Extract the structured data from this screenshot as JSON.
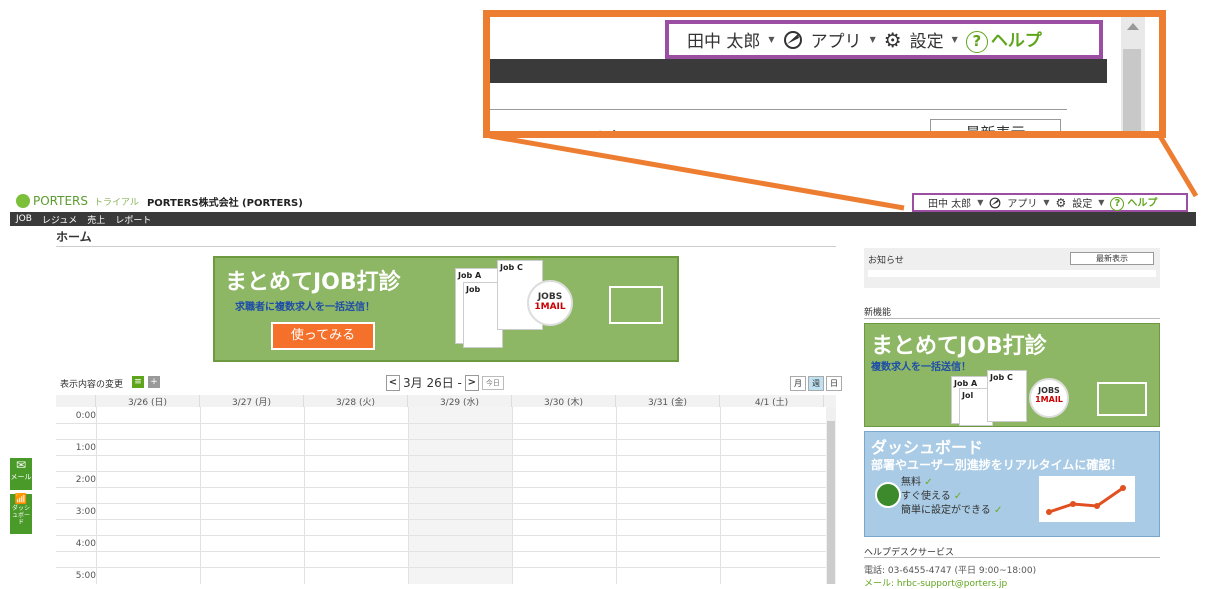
{
  "colors": {
    "accent_orange": "#ed7d31",
    "highlight_purple": "#9c4ea3",
    "brand_green": "#5fa51c",
    "nav_dark": "#3a3a3a"
  },
  "zoom": {
    "user_name": "田中 太郎",
    "apps_label": "アプリ",
    "settings_label": "設定",
    "help_label": "ヘルプ",
    "notice_label": "お知らせ",
    "latest_button": "最新表示"
  },
  "header": {
    "logo_text": "PORTERS",
    "trial_label": "トライアル",
    "company": "PORTERS株式会社 (PORTERS)",
    "user_name": "田中 太郎",
    "apps_label": "アプリ",
    "settings_label": "設定",
    "help_label": "ヘルプ"
  },
  "nav": {
    "items": [
      "JOB",
      "レジュメ",
      "売上",
      "レポート"
    ]
  },
  "page": {
    "title": "ホーム"
  },
  "banner": {
    "title": "まとめてJOB打診",
    "subtitle": "求職者に複数求人を一括送信！",
    "button": "使ってみる",
    "doc_a": "Job A",
    "doc_b": "Job",
    "doc_c": "Job C",
    "badge_top": "JOBS",
    "badge_bottom": "1MAIL"
  },
  "calendar_controls": {
    "change_label": "表示内容の変更",
    "date_label": "3月 26日 -",
    "today_label": "今日",
    "view_month": "月",
    "view_week": "週",
    "view_day": "日"
  },
  "calendar": {
    "days": [
      "3/26 (日)",
      "3/27 (月)",
      "3/28 (火)",
      "3/29 (水)",
      "3/30 (木)",
      "3/31 (金)",
      "4/1 (土)"
    ],
    "times": [
      "0:00",
      "1:00",
      "2:00",
      "3:00",
      "4:00",
      "5:00"
    ]
  },
  "sidebar": {
    "notice_label": "お知らせ",
    "latest_button": "最新表示",
    "new_features": "新機能",
    "banner_title": "まとめてJOB打診",
    "banner_subtitle": "複数求人を一括送信！",
    "banner_doc_a": "Job A",
    "banner_doc_b": "Jol",
    "banner_doc_c": "Job C",
    "banner_badge_top": "JOBS",
    "banner_badge_bottom": "1MAIL",
    "dash_title": "ダッシュボード",
    "dash_subtitle": "部署やユーザー別進捗をリアルタイムに確認！",
    "dash_points": [
      "無料",
      "すぐ使える",
      "簡単に設定ができる"
    ],
    "helpdesk_title": "ヘルプデスクサービス",
    "helpdesk_phone": "電話: 03-6455-4747 (平日 9:00~18:00)",
    "helpdesk_mail": "メール: hrbc-support@porters.jp"
  },
  "dock": {
    "mail": "メール",
    "dashboard": "ダッシュボード"
  }
}
